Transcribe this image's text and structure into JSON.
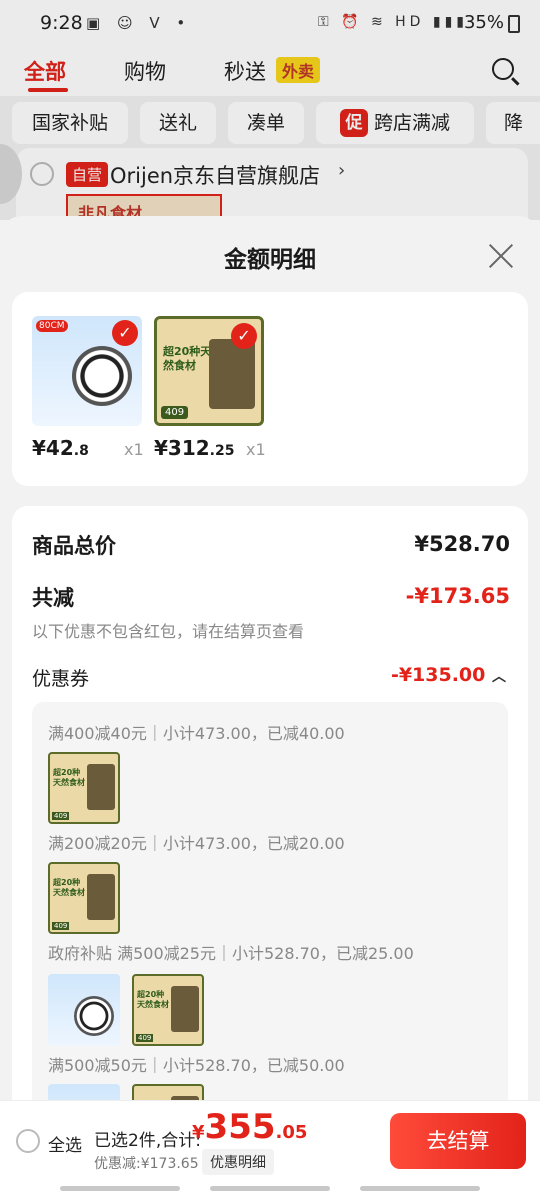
{
  "status": {
    "time": "9:28",
    "left_icons": "▣ ☺ V •",
    "right_icons": "⚿ ⏰ ≋ HD ▮▮▮",
    "battery": "35%"
  },
  "top_tabs": {
    "all": "全部",
    "shopping": "购物",
    "flash": "秒送",
    "takeout_badge": "外卖"
  },
  "chips": [
    "国家补贴",
    "送礼",
    "凑单",
    "跨店满减",
    "降"
  ],
  "promo_icon": "促",
  "store": {
    "badge": "自营",
    "name": "Orijen京东自营旗舰店",
    "chevron": "›",
    "thumb_text": "非凡食材"
  },
  "sheet": {
    "title": "金额明细",
    "products": [
      {
        "tag": "80CM",
        "price_int": "¥42",
        "price_dec": ".8",
        "qty": "x1"
      },
      {
        "text": "超20种天然食材",
        "badge": "409",
        "price_int": "¥312",
        "price_dec": ".25",
        "qty": "x1"
      }
    ],
    "goods_total_label": "商品总价",
    "goods_total_value": "¥528.70",
    "discount_label": "共减",
    "discount_value": "-¥173.65",
    "note": "以下优惠不包含红包，请在结算页查看",
    "coupon_label": "优惠券",
    "coupon_value": "-¥135.00",
    "coupon_chevron": "︿",
    "rules": [
      "满400减40元｜小计473.00，已减40.00",
      "满200减20元｜小计473.00，已减20.00",
      "政府补贴 满500减25元｜小计528.70，已减25.00",
      "满500减50元｜小计528.70，已减50.00"
    ],
    "thumb_food_text": "超20种天然食材",
    "thumb_badge": "409"
  },
  "bottom": {
    "select_all": "全选",
    "selected": "已选2件,合计:",
    "currency": "¥",
    "total_int": "355",
    "total_dec": ".05",
    "saved": "优惠减:¥173.65",
    "detail": "优惠明细",
    "checkout": "去结算"
  }
}
